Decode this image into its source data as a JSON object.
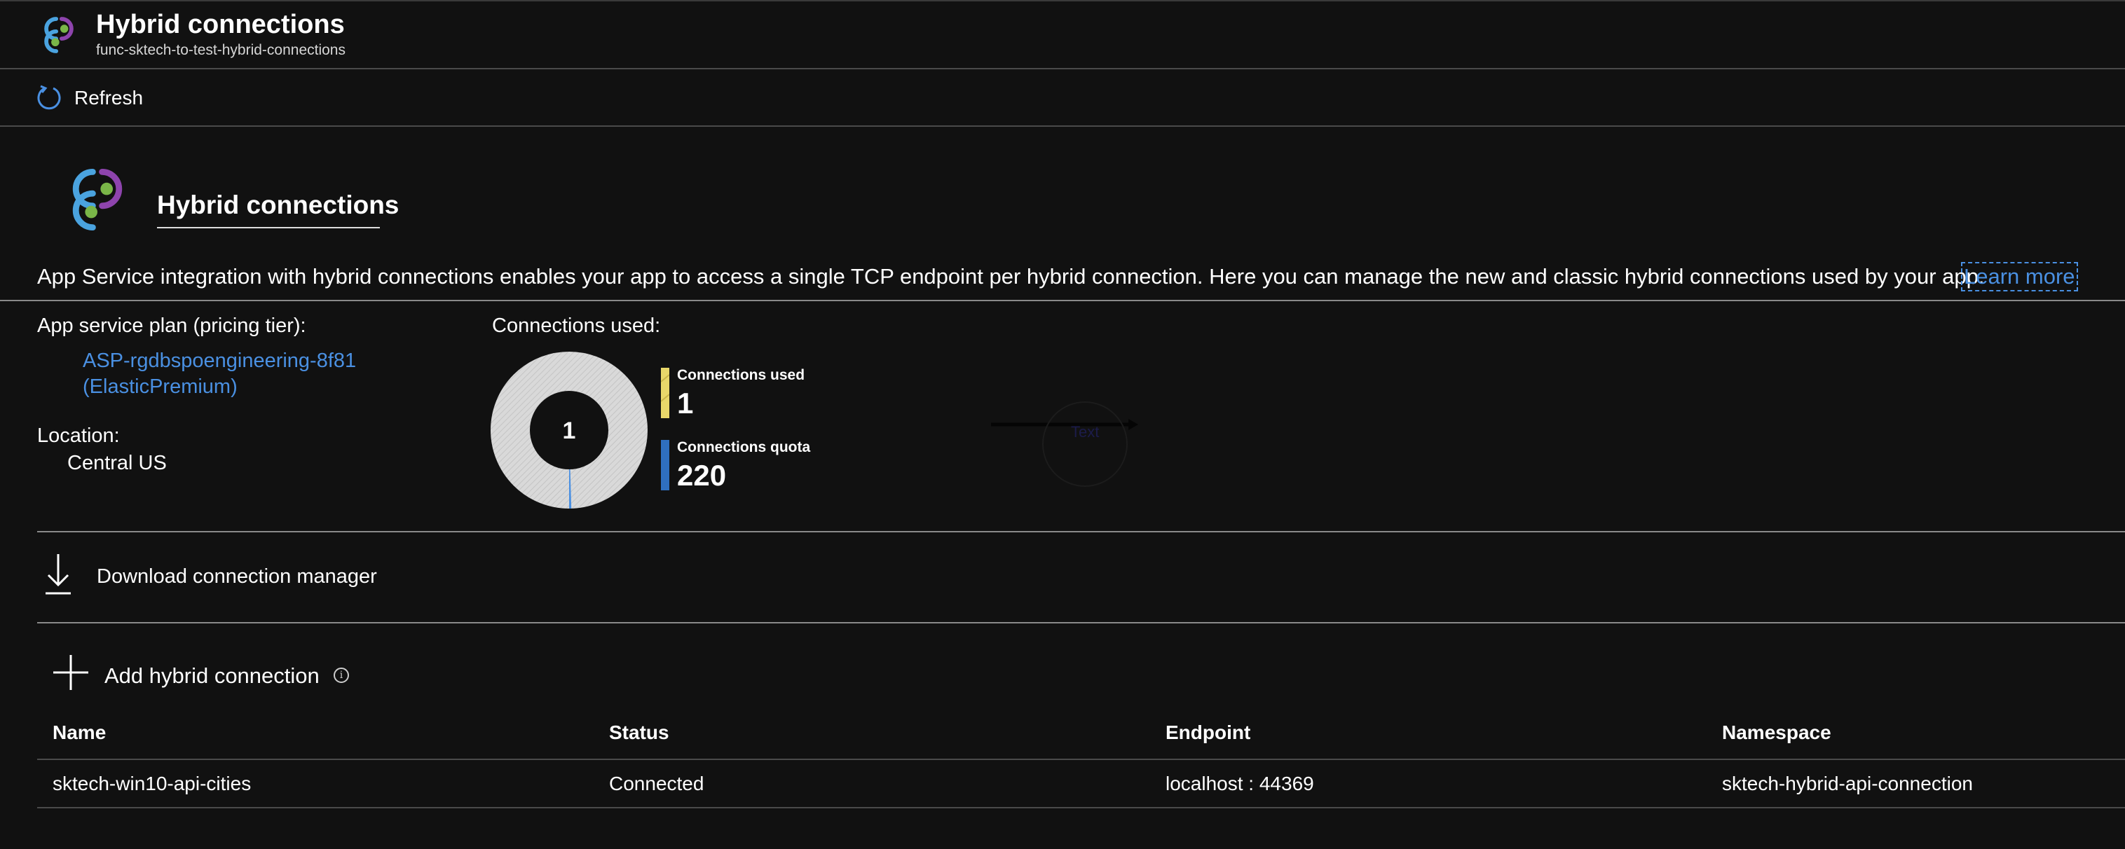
{
  "header": {
    "title": "Hybrid connections",
    "subtitle": "func-sktech-to-test-hybrid-connections",
    "icon": "hybrid-connections-icon"
  },
  "toolbar": {
    "refresh_label": "Refresh",
    "refresh_icon": "refresh-icon"
  },
  "section": {
    "heading": "Hybrid connections",
    "description": "App Service integration with hybrid connections enables your app to access a single TCP endpoint per hybrid connection. Here you can manage the new and classic hybrid connections used by your app.",
    "learn_more": "Learn more"
  },
  "plan": {
    "label": "App service plan (pricing tier):",
    "name": "ASP-rgdbspoengineering-8f81",
    "tier": "(ElasticPremium)",
    "location_label": "Location:",
    "location_value": "Central US"
  },
  "usage": {
    "label": "Connections used:",
    "donut_center": "1",
    "used_label": "Connections used",
    "used_value": "1",
    "quota_label": "Connections quota",
    "quota_value": "220",
    "artifact_text": "Text"
  },
  "chart_data": {
    "type": "pie",
    "categories": [
      "Connections used",
      "Connections quota"
    ],
    "values": [
      1,
      220
    ]
  },
  "actions": {
    "download_label": "Download connection manager",
    "add_label": "Add hybrid connection",
    "info_glyph": "i"
  },
  "table": {
    "columns": [
      "Name",
      "Status",
      "Endpoint",
      "Namespace"
    ],
    "rows": [
      [
        "sktech-win10-api-cities",
        "Connected",
        "localhost : 44369",
        "sktech-hybrid-api-connection"
      ]
    ]
  },
  "colors": {
    "background": "#111111",
    "link": "#4a90e2",
    "used_bar": "#e8d76a",
    "quota_bar": "#2f6fbf",
    "donut_ring": "#d9d9d9"
  }
}
